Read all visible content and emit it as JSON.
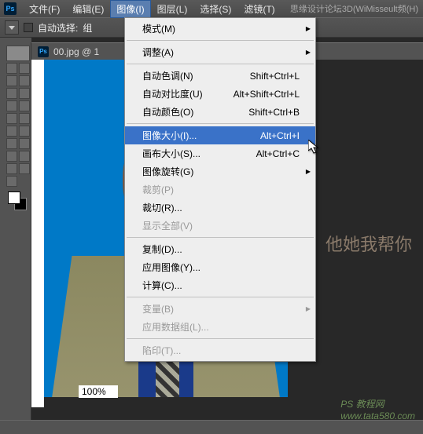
{
  "menubar": {
    "file": "文件(F)",
    "edit": "编辑(E)",
    "image": "图像(I)",
    "layer": "图层(L)",
    "select": "选择(S)",
    "filter": "滤镜(T)"
  },
  "watermark_top": "思缘设计论坛3D(WiMisseult频(H)",
  "optbar": {
    "auto_select": "自动选择:",
    "group": "组"
  },
  "doc_tab": "00.jpg @ 1",
  "zoom": "100%",
  "dropdown": {
    "mode": "模式(M)",
    "adjust": "调整(A)",
    "auto_tone": {
      "label": "自动色调(N)",
      "shortcut": "Shift+Ctrl+L"
    },
    "auto_contrast": {
      "label": "自动对比度(U)",
      "shortcut": "Alt+Shift+Ctrl+L"
    },
    "auto_color": {
      "label": "自动颜色(O)",
      "shortcut": "Shift+Ctrl+B"
    },
    "image_size": {
      "label": "图像大小(I)...",
      "shortcut": "Alt+Ctrl+I"
    },
    "canvas_size": {
      "label": "画布大小(S)...",
      "shortcut": "Alt+Ctrl+C"
    },
    "rotate": "图像旋转(G)",
    "crop": "裁剪(P)",
    "trim": "裁切(R)...",
    "reveal": "显示全部(V)",
    "duplicate": "复制(D)...",
    "apply": "应用图像(Y)...",
    "calc": "计算(C)...",
    "variable": "变量(B)",
    "dataset": "应用数据组(L)...",
    "trap": "陷印(T)..."
  },
  "side_text_1": "他她我帮你",
  "footer_1": "PS 教程网",
  "footer_2": "www.tata580.com"
}
